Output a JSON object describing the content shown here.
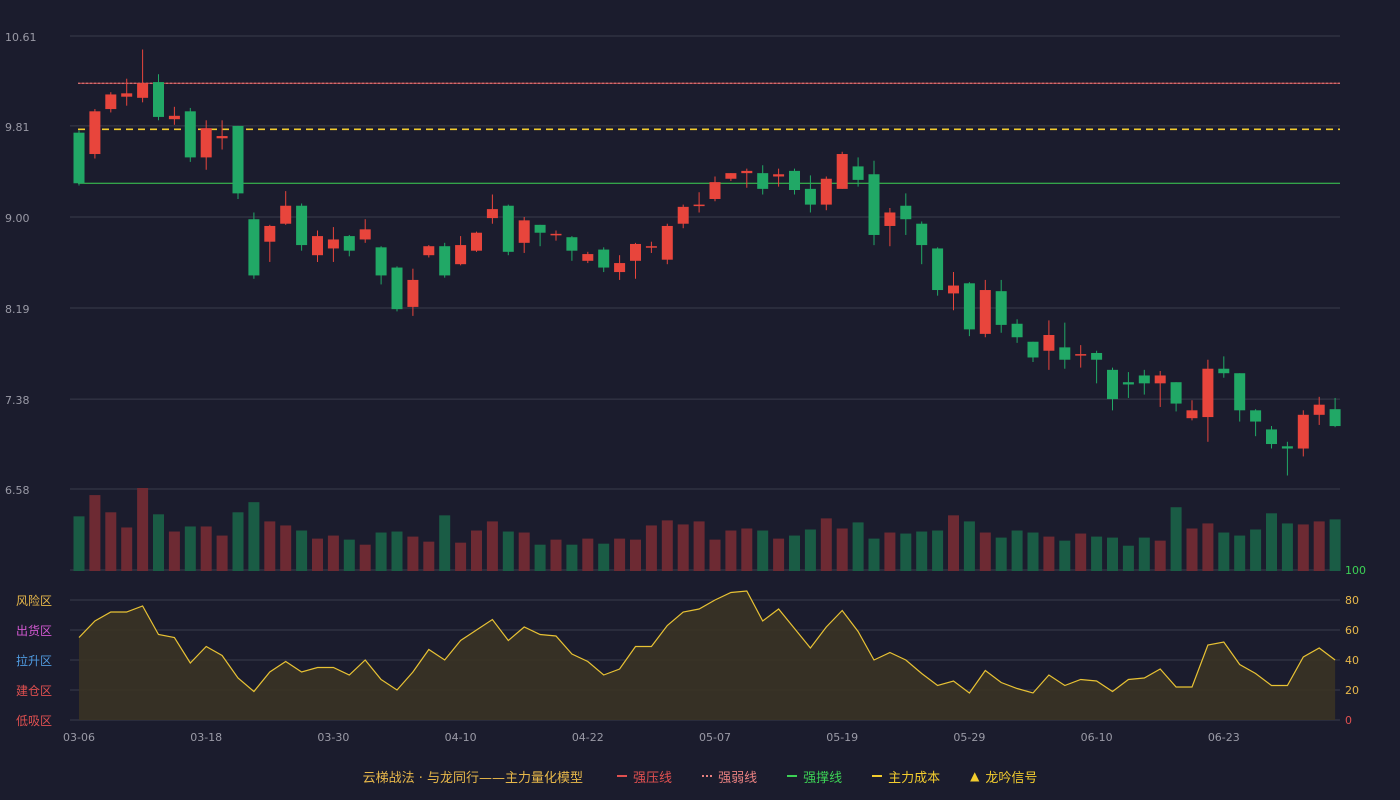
{
  "chart_data": [
    {
      "type": "candlestick",
      "ylim": [
        6.58,
        10.61
      ],
      "yticks": [
        "10.61",
        "9.81",
        "9.00",
        "8.19",
        "7.38",
        "6.58"
      ],
      "xticks": [
        {
          "index": 0,
          "label": "03-06"
        },
        {
          "index": 8,
          "label": "03-18"
        },
        {
          "index": 16,
          "label": "03-30"
        },
        {
          "index": 24,
          "label": "04-10"
        },
        {
          "index": 32,
          "label": "04-22"
        },
        {
          "index": 40,
          "label": "05-07"
        },
        {
          "index": 48,
          "label": "05-19"
        },
        {
          "index": 56,
          "label": "05-29"
        },
        {
          "index": 64,
          "label": "06-10"
        },
        {
          "index": 72,
          "label": "06-23"
        }
      ],
      "candles": [
        [
          9.75,
          9.3,
          9.77,
          9.28
        ],
        [
          9.56,
          9.94,
          9.96,
          9.52
        ],
        [
          9.96,
          10.09,
          10.11,
          9.93
        ],
        [
          10.07,
          10.1,
          10.23,
          9.99
        ],
        [
          10.06,
          10.19,
          10.49,
          10.02
        ],
        [
          10.2,
          9.89,
          10.27,
          9.86
        ],
        [
          9.87,
          9.9,
          9.98,
          9.82
        ],
        [
          9.94,
          9.53,
          9.97,
          9.49
        ],
        [
          9.53,
          9.79,
          9.86,
          9.42
        ],
        [
          9.7,
          9.72,
          9.86,
          9.6
        ],
        [
          9.81,
          9.21,
          9.81,
          9.16
        ],
        [
          8.98,
          8.48,
          9.04,
          8.45
        ],
        [
          8.78,
          8.92,
          8.93,
          8.6
        ],
        [
          8.94,
          9.1,
          9.23,
          8.93
        ],
        [
          9.1,
          8.75,
          9.12,
          8.7
        ],
        [
          8.66,
          8.83,
          8.88,
          8.6
        ],
        [
          8.72,
          8.8,
          8.91,
          8.6
        ],
        [
          8.83,
          8.7,
          8.84,
          8.65
        ],
        [
          8.8,
          8.89,
          8.98,
          8.77
        ],
        [
          8.73,
          8.48,
          8.74,
          8.4
        ],
        [
          8.55,
          8.18,
          8.56,
          8.16
        ],
        [
          8.2,
          8.44,
          8.54,
          8.12
        ],
        [
          8.66,
          8.74,
          8.75,
          8.64
        ],
        [
          8.74,
          8.48,
          8.77,
          8.46
        ],
        [
          8.58,
          8.75,
          8.83,
          8.57
        ],
        [
          8.7,
          8.86,
          8.87,
          8.69
        ],
        [
          8.99,
          9.07,
          9.2,
          8.94
        ],
        [
          9.1,
          8.69,
          9.11,
          8.66
        ],
        [
          8.77,
          8.97,
          9.0,
          8.68
        ],
        [
          8.93,
          8.86,
          8.93,
          8.74
        ],
        [
          8.85,
          8.85,
          8.88,
          8.79
        ],
        [
          8.82,
          8.7,
          8.83,
          8.61
        ],
        [
          8.61,
          8.67,
          8.69,
          8.59
        ],
        [
          8.71,
          8.55,
          8.73,
          8.51
        ],
        [
          8.51,
          8.59,
          8.66,
          8.44
        ],
        [
          8.61,
          8.76,
          8.77,
          8.45
        ],
        [
          8.74,
          8.74,
          8.78,
          8.68
        ],
        [
          8.62,
          8.92,
          8.94,
          8.58
        ],
        [
          8.94,
          9.09,
          9.11,
          8.9
        ],
        [
          9.1,
          9.11,
          9.22,
          9.04
        ],
        [
          9.16,
          9.31,
          9.36,
          9.14
        ],
        [
          9.34,
          9.39,
          9.39,
          9.32
        ],
        [
          9.39,
          9.41,
          9.43,
          9.26
        ],
        [
          9.39,
          9.25,
          9.46,
          9.2
        ],
        [
          9.36,
          9.38,
          9.43,
          9.27
        ],
        [
          9.41,
          9.24,
          9.43,
          9.2
        ],
        [
          9.25,
          9.11,
          9.37,
          9.04
        ],
        [
          9.11,
          9.34,
          9.36,
          9.06
        ],
        [
          9.25,
          9.56,
          9.58,
          9.25
        ],
        [
          9.45,
          9.33,
          9.53,
          9.27
        ],
        [
          9.38,
          8.84,
          9.5,
          8.75
        ],
        [
          8.92,
          9.04,
          9.08,
          8.74
        ],
        [
          9.1,
          8.98,
          9.21,
          8.84
        ],
        [
          8.94,
          8.75,
          8.96,
          8.58
        ],
        [
          8.72,
          8.35,
          8.73,
          8.3
        ],
        [
          8.32,
          8.39,
          8.51,
          8.17
        ],
        [
          8.41,
          8.0,
          8.42,
          7.94
        ],
        [
          7.96,
          8.35,
          8.44,
          7.93
        ],
        [
          8.34,
          8.04,
          8.44,
          7.97
        ],
        [
          8.05,
          7.93,
          8.09,
          7.88
        ],
        [
          7.89,
          7.75,
          7.89,
          7.71
        ],
        [
          7.81,
          7.95,
          8.08,
          7.64
        ],
        [
          7.84,
          7.73,
          8.06,
          7.65
        ],
        [
          7.78,
          7.78,
          7.86,
          7.66
        ],
        [
          7.79,
          7.73,
          7.81,
          7.52
        ],
        [
          7.64,
          7.38,
          7.66,
          7.28
        ],
        [
          7.53,
          7.51,
          7.62,
          7.39
        ],
        [
          7.59,
          7.52,
          7.64,
          7.42
        ],
        [
          7.52,
          7.59,
          7.63,
          7.31
        ],
        [
          7.53,
          7.34,
          7.53,
          7.27
        ],
        [
          7.21,
          7.28,
          7.37,
          7.19
        ],
        [
          7.22,
          7.65,
          7.73,
          7.0
        ],
        [
          7.65,
          7.61,
          7.76,
          7.57
        ],
        [
          7.61,
          7.28,
          7.61,
          7.18
        ],
        [
          7.28,
          7.18,
          7.29,
          7.05
        ],
        [
          7.11,
          6.98,
          7.14,
          6.94
        ],
        [
          6.96,
          6.94,
          7.0,
          6.7
        ],
        [
          6.94,
          7.24,
          7.28,
          6.87
        ],
        [
          7.24,
          7.33,
          7.4,
          7.15
        ],
        [
          7.29,
          7.14,
          7.39,
          7.13
        ]
      ],
      "hlines": [
        {
          "name": "强压线",
          "value": 10.19,
          "color": "#e05050",
          "style": "solid"
        },
        {
          "name": "强弱线",
          "value": 10.19,
          "color": "#e88080",
          "style": "dotted"
        },
        {
          "name": "主力成本",
          "value": 9.78,
          "color": "#f2cc2e",
          "style": "dashed"
        },
        {
          "name": "强撑线",
          "value": 9.3,
          "color": "#3cd155",
          "style": "solid"
        }
      ]
    },
    {
      "type": "bar",
      "volumes": [
        54,
        75,
        58,
        43,
        82,
        56,
        39,
        44,
        44,
        35,
        58,
        68,
        49,
        45,
        40,
        32,
        35,
        31,
        26,
        38,
        39,
        34,
        29,
        55,
        28,
        40,
        49,
        39,
        38,
        26,
        31,
        26,
        32,
        27,
        32,
        31,
        45,
        50,
        46,
        49,
        31,
        40,
        42,
        40,
        32,
        35,
        41,
        52,
        42,
        48,
        32,
        38,
        37,
        39,
        40,
        55,
        49,
        38,
        33,
        40,
        38,
        34,
        30,
        37,
        34,
        33,
        25,
        33,
        30,
        63,
        42,
        47,
        38,
        35,
        41,
        57,
        47,
        46,
        49,
        51
      ],
      "volume_max": 82,
      "colors": {
        "up": "#6d2a33",
        "down": "#1a5c45"
      }
    },
    {
      "type": "area",
      "ylim": [
        0,
        100
      ],
      "yticks": [
        "100",
        "80",
        "60",
        "40",
        "20",
        "0"
      ],
      "ytick_colors": [
        "#3cd155",
        "#e8b84a",
        "#e8b84a",
        "#e8b84a",
        "#e8b84a",
        "#e05050"
      ],
      "zone_labels": [
        {
          "label": "风险区",
          "color": "#e8b84a",
          "level": 80
        },
        {
          "label": "出货区",
          "color": "#d158d0",
          "level": 60
        },
        {
          "label": "拉升区",
          "color": "#4f9ae0",
          "level": 40
        },
        {
          "label": "建仓区",
          "color": "#e05050",
          "level": 20
        },
        {
          "label": "低吸区",
          "color": "#e05050",
          "level": 0
        }
      ],
      "values": [
        55,
        66,
        72,
        72,
        76,
        57,
        55,
        38,
        49,
        43,
        28,
        19,
        32,
        39,
        32,
        35,
        35,
        30,
        40,
        27,
        20,
        32,
        47,
        40,
        53,
        60,
        67,
        53,
        62,
        57,
        56,
        44,
        39,
        30,
        34,
        49,
        49,
        63,
        72,
        74,
        80,
        85,
        86,
        66,
        74,
        61,
        48,
        62,
        73,
        59,
        40,
        45,
        40,
        31,
        23,
        26,
        18,
        33,
        25,
        21,
        18,
        30,
        23,
        27,
        26,
        19,
        27,
        28,
        34,
        22,
        22,
        50,
        52,
        37,
        31,
        23,
        23,
        42,
        48,
        40
      ],
      "line_color": "#e8c234",
      "fill_color": "#3a3325"
    }
  ],
  "legend": {
    "title": "云梯战法 · 与龙同行——主力量化模型",
    "items": [
      {
        "label": "强压线",
        "color": "#e05050",
        "style": "solid"
      },
      {
        "label": "强弱线",
        "color": "#e88080",
        "style": "dotted"
      },
      {
        "label": "强撑线",
        "color": "#3cd155",
        "style": "solid"
      },
      {
        "label": "主力成本",
        "color": "#f2cc2e",
        "style": "dashed"
      },
      {
        "label": "龙吟信号",
        "color": "#f2cc2e",
        "style": "triangle",
        "icon": "triangle-icon"
      }
    ]
  },
  "colors": {
    "background": "#1b1c2d",
    "grid": "#3a3b4c",
    "axis_text": "#9a9aa6",
    "up": "#e8453c",
    "down": "#21a866"
  }
}
